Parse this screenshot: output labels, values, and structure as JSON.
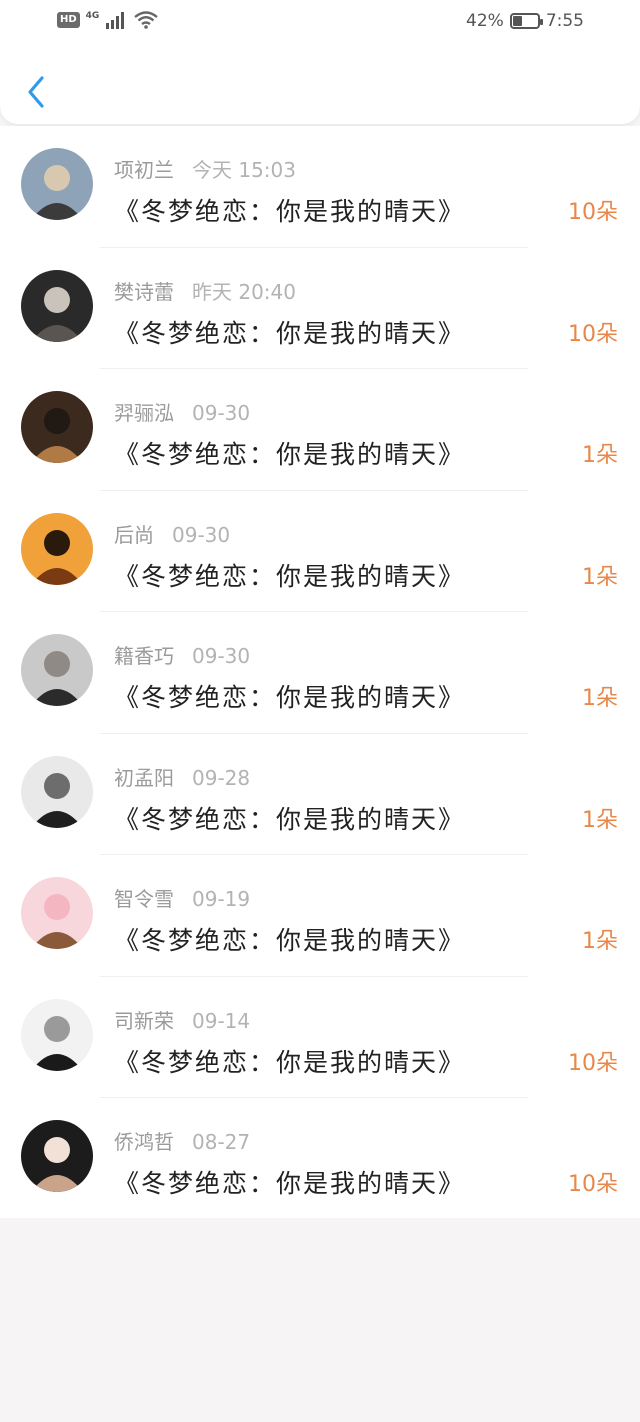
{
  "status_bar": {
    "hd": "HD",
    "network": "4G",
    "battery_percent": "42%",
    "battery_level": 0.42,
    "time": "7:55",
    "icons": [
      "signal-icon",
      "wifi-icon",
      "battery-icon"
    ]
  },
  "header": {
    "back_icon": "chevron-left-icon",
    "accent_color": "#2f9bea"
  },
  "colors": {
    "amount": "#e8874a",
    "name": "#9b9b9b",
    "title": "#222222"
  },
  "records": [
    {
      "name": "项初兰",
      "time": "今天 15:03",
      "title": "《冬梦绝恋：你是我的晴天》",
      "amount": "10朵",
      "avatar": "avatar-icon"
    },
    {
      "name": "樊诗蕾",
      "time": "昨天 20:40",
      "title": "《冬梦绝恋：你是我的晴天》",
      "amount": "10朵",
      "avatar": "avatar-icon"
    },
    {
      "name": "羿骊泓",
      "time": "09-30",
      "title": "《冬梦绝恋：你是我的晴天》",
      "amount": "1朵",
      "avatar": "avatar-icon"
    },
    {
      "name": "后尚",
      "time": "09-30",
      "title": "《冬梦绝恋：你是我的晴天》",
      "amount": "1朵",
      "avatar": "avatar-icon"
    },
    {
      "name": "籍香巧",
      "time": "09-30",
      "title": "《冬梦绝恋：你是我的晴天》",
      "amount": "1朵",
      "avatar": "avatar-icon"
    },
    {
      "name": "初孟阳",
      "time": "09-28",
      "title": "《冬梦绝恋：你是我的晴天》",
      "amount": "1朵",
      "avatar": "avatar-icon"
    },
    {
      "name": "智令雪",
      "time": "09-19",
      "title": "《冬梦绝恋：你是我的晴天》",
      "amount": "1朵",
      "avatar": "avatar-icon"
    },
    {
      "name": "司新荣",
      "time": "09-14",
      "title": "《冬梦绝恋：你是我的晴天》",
      "amount": "10朵",
      "avatar": "avatar-icon"
    },
    {
      "name": "侨鸿哲",
      "time": "08-27",
      "title": "《冬梦绝恋：你是我的晴天》",
      "amount": "10朵",
      "avatar": "avatar-icon"
    }
  ]
}
